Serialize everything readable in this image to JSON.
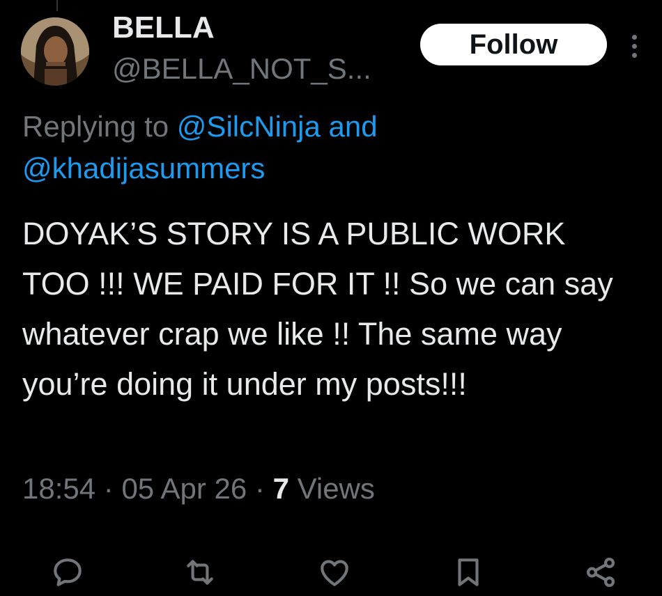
{
  "tweet": {
    "author": {
      "display_name": "BELLA",
      "handle": "@BELLA_NOT_S..."
    },
    "follow_label": "Follow",
    "reply_to": {
      "prefix": "Replying to ",
      "mention_1": "@SilcNinja",
      "joiner": " and",
      "mention_2": "@khadijasummers"
    },
    "text": "DOYAK’S STORY IS A PUBLIC WORK TOO !!! WE PAID FOR IT !! So we can say whatever crap we like !! The same way you’re doing it under my posts!!!",
    "time": "18:54",
    "date": "05 Apr 26",
    "separator": " · ",
    "views_count": "7",
    "views_label": " Views"
  },
  "actions": [
    {
      "name": "reply-icon"
    },
    {
      "name": "retweet-icon"
    },
    {
      "name": "like-icon"
    },
    {
      "name": "bookmark-icon"
    },
    {
      "name": "share-icon"
    }
  ],
  "colors": {
    "background": "#000000",
    "text_primary": "#e7e9ea",
    "text_secondary": "#71767b",
    "accent": "#1d9bf0",
    "follow_bg": "#ffffff",
    "icon": "#71767b"
  }
}
